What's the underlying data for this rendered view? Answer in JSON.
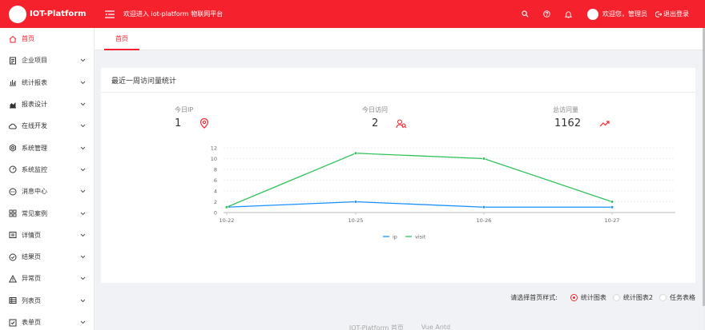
{
  "header": {
    "logo_text": "IOT-Platform",
    "welcome": "欢迎进入 iot-platform 物联网平台",
    "user": "欢迎您，管理员",
    "logout": "退出登录",
    "icons": [
      "search-icon",
      "question-icon",
      "bell-icon"
    ]
  },
  "sidebar": {
    "items": [
      {
        "label": "首页",
        "icon": "home-icon",
        "active": true,
        "has_children": false
      },
      {
        "label": "企业项目",
        "icon": "project-icon",
        "has_children": true
      },
      {
        "label": "统计报表",
        "icon": "bar-chart-icon",
        "has_children": true
      },
      {
        "label": "报表设计",
        "icon": "area-chart-icon",
        "has_children": true
      },
      {
        "label": "在线开发",
        "icon": "cloud-icon",
        "has_children": true
      },
      {
        "label": "系统管理",
        "icon": "settings-icon",
        "has_children": true
      },
      {
        "label": "系统监控",
        "icon": "dashboard-icon",
        "has_children": true
      },
      {
        "label": "消息中心",
        "icon": "message-icon",
        "has_children": true
      },
      {
        "label": "常见案例",
        "icon": "appstore-icon",
        "has_children": true
      },
      {
        "label": "详情页",
        "icon": "profile-icon",
        "has_children": true
      },
      {
        "label": "结果页",
        "icon": "check-circle-icon",
        "has_children": true
      },
      {
        "label": "异常页",
        "icon": "warning-icon",
        "has_children": true
      },
      {
        "label": "列表页",
        "icon": "table-icon",
        "has_children": true
      },
      {
        "label": "表单页",
        "icon": "form-icon",
        "has_children": true
      }
    ]
  },
  "tabs": [
    {
      "label": "首页",
      "active": true
    }
  ],
  "card": {
    "title": "最近一周访问量统计",
    "stats": [
      {
        "label": "今日IP",
        "value": "1",
        "icon": "location-icon"
      },
      {
        "label": "今日访问",
        "value": "2",
        "icon": "team-icon"
      },
      {
        "label": "总访问量",
        "value": "1162",
        "icon": "rise-icon"
      }
    ]
  },
  "chart_data": {
    "type": "line",
    "x": [
      "10-22",
      "10-25",
      "10-26",
      "10-27"
    ],
    "series": [
      {
        "name": "ip",
        "values": [
          1,
          2,
          1,
          1
        ],
        "color": "#1890ff"
      },
      {
        "name": "visit",
        "values": [
          1,
          11,
          10,
          2
        ],
        "color": "#2fc25b"
      }
    ],
    "yticks": [
      "0",
      "2",
      "4",
      "6",
      "8",
      "10",
      "12"
    ],
    "ylim": [
      0,
      12
    ],
    "legend": "bottom-center"
  },
  "style_select": {
    "label": "请选择首页样式:",
    "options": [
      {
        "label": "统计图表",
        "checked": true
      },
      {
        "label": "统计图表2",
        "checked": false
      },
      {
        "label": "任务表格",
        "checked": false
      }
    ]
  },
  "footer": {
    "links": [
      "IOT-Platform 首页",
      "Vue Antd"
    ]
  },
  "colors": {
    "primary": "#f5222d",
    "ip": "#1890ff",
    "visit": "#2fc25b"
  }
}
